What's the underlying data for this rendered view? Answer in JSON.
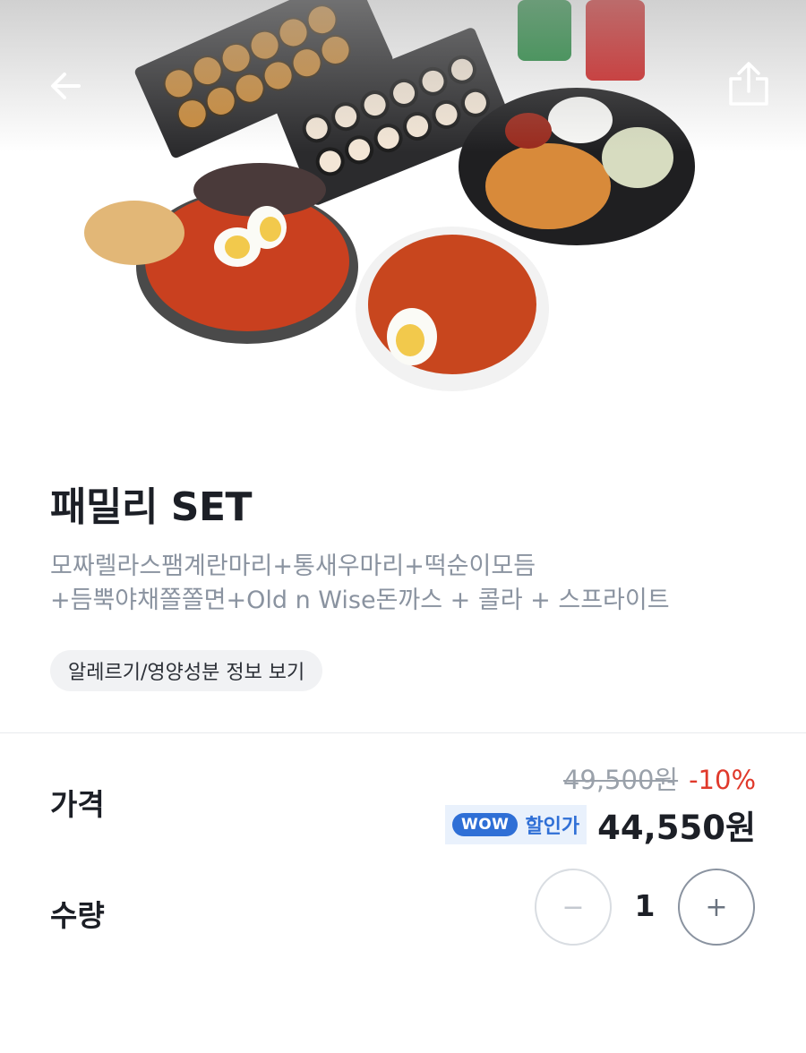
{
  "header": {
    "back_icon": "arrow-left-icon",
    "share_icon": "share-icon"
  },
  "product": {
    "title": "패밀리 SET",
    "description_line1": "모짜렐라스팸계란마리+통새우마리+떡순이모듬",
    "description_line2": "+듬뿍야채쫄쫄면+Old n Wise돈까스 + 콜라 + 스프라이트",
    "allergy_button_label": "알레르기/영양성분 정보 보기"
  },
  "price": {
    "label": "가격",
    "original_price": "49,500원",
    "discount_rate": "-10%",
    "wow_badge": "WOW",
    "wow_label": "할인가",
    "final_price": "44,550원"
  },
  "quantity": {
    "label": "수량",
    "minus_symbol": "−",
    "value": "1",
    "plus_symbol": "+"
  },
  "colors": {
    "accent_blue": "#2f6fd6",
    "discount_red": "#e0392b",
    "muted_text": "#8a93a0"
  }
}
